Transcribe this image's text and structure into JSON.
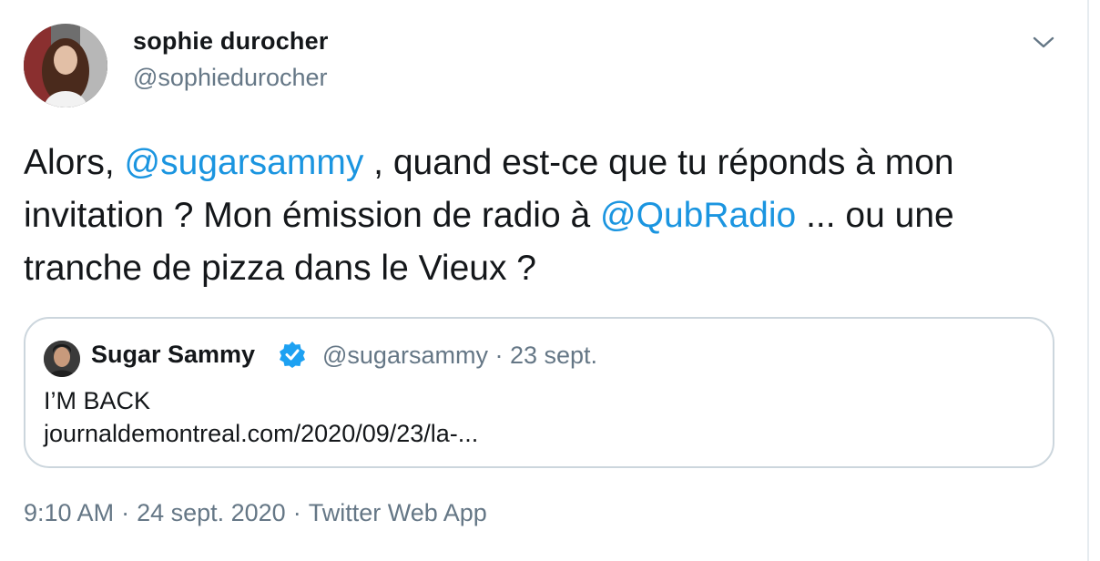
{
  "author": {
    "display_name": "sophie durocher",
    "handle": "@sophiedurocher",
    "avatar_icon": "profile-photo"
  },
  "tweet": {
    "text_parts": {
      "p1": "Alors, ",
      "mention1": "@sugarsammy",
      "p2": " , quand est-ce que tu réponds à mon invitation ? Mon émission de radio à ",
      "mention2": "@QubRadio",
      "p3": " ... ou une tranche de pizza dans le Vieux ?"
    }
  },
  "quoted_tweet": {
    "display_name": "Sugar Sammy",
    "verified_icon": "verified-badge-icon",
    "meta": "@sugarsammy · 23 sept.",
    "line1": "I’M BACK",
    "line2": "journaldemontreal.com/2020/09/23/la-..."
  },
  "footer": {
    "time": "9:10 AM",
    "date": "24 sept. 2020",
    "separator": "·",
    "source": "Twitter Web App"
  },
  "colors": {
    "link": "#1b95e0",
    "muted": "#657786",
    "border": "#ccd6dd",
    "verified": "#1da1f2"
  }
}
